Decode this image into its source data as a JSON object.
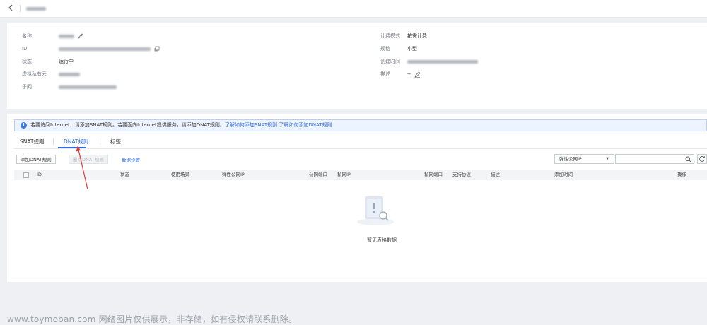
{
  "header": {
    "back_icon": "chevron-left-icon"
  },
  "info": {
    "left": [
      {
        "label": "名称"
      },
      {
        "label": "ID"
      },
      {
        "label": "状态",
        "value": "运行中"
      },
      {
        "label": "虚拟私有云"
      },
      {
        "label": "子网"
      }
    ],
    "right": [
      {
        "label": "计费模式",
        "value": "按需计费"
      },
      {
        "label": "规格",
        "value": "小型"
      },
      {
        "label": "创建时间"
      },
      {
        "label": "描述",
        "value": "--"
      }
    ]
  },
  "notice": {
    "text": "若要访问Internet，请添加SNAT规则。若要面向Internet提供服务，请添加DNAT规则。",
    "link1": "了解如何添加SNAT规则",
    "link2": "了解如何添加DNAT规则"
  },
  "tabs": [
    "SNAT规则",
    "DNAT规则",
    "标签"
  ],
  "toolbar": {
    "add_label": "添加DNAT规则",
    "delete_label": "删除DNAT规则",
    "settings_label": "数据设置",
    "filter_value": "弹性公网IP"
  },
  "table": {
    "columns": [
      "ID",
      "状态",
      "使用场景",
      "弹性公网IP",
      "公网端口",
      "私网IP",
      "私网端口",
      "支持协议",
      "描述",
      "添加时间",
      "操作"
    ],
    "empty_text": "暂无表格数据"
  },
  "watermark": "www.toymoban.com 网络图片仅供展示，非存储，如有侵权请联系删除。",
  "colors": {
    "accent": "#2e6bdf",
    "annotation_arrow": "#e03a3a"
  }
}
